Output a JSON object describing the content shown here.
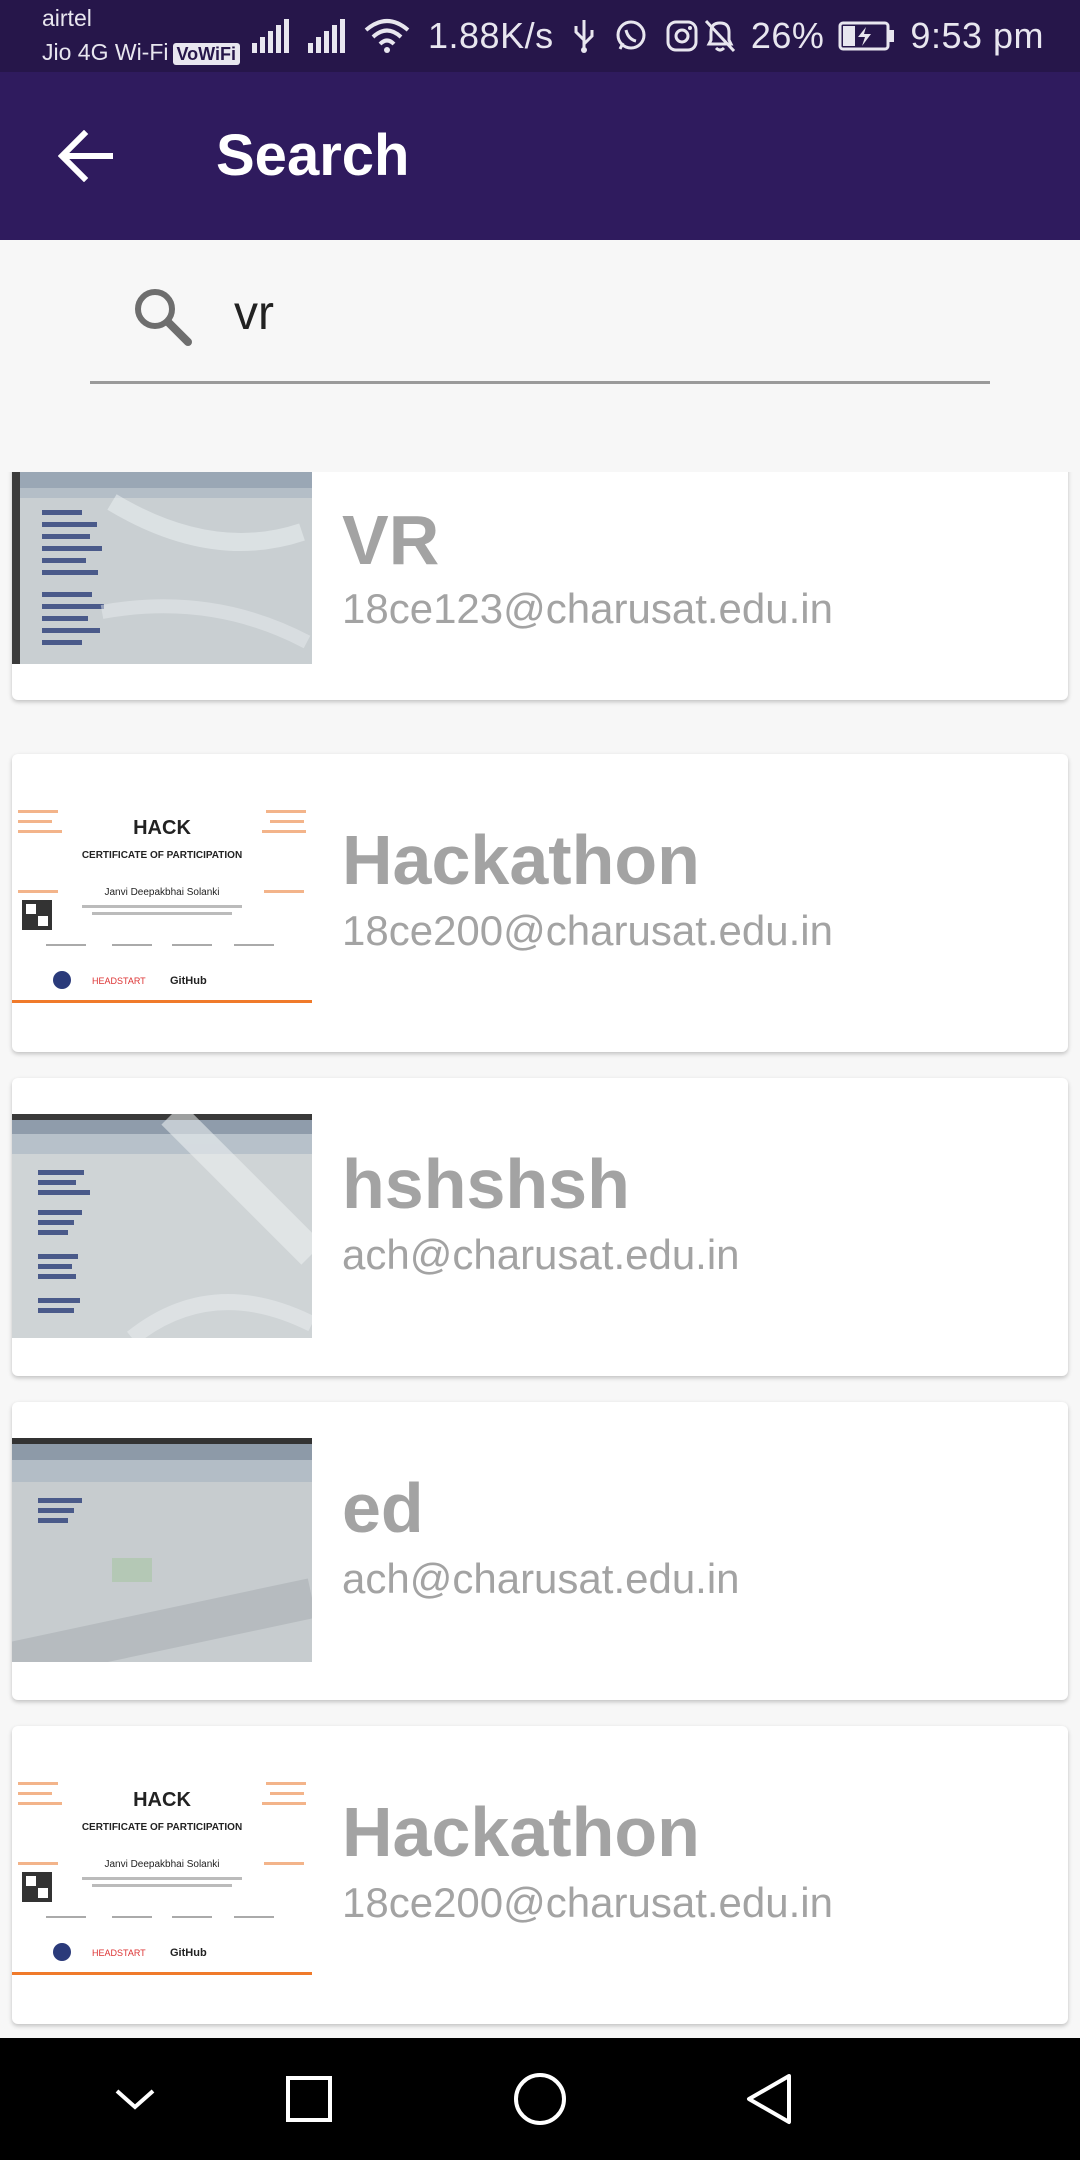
{
  "status_bar": {
    "carrier1": "airtel",
    "carrier2": "Jio 4G Wi-Fi",
    "vowifi": "VoWiFi",
    "speed": "1.88K/s",
    "battery": "26%",
    "time": "9:53 pm"
  },
  "appbar": {
    "title": "Search"
  },
  "search": {
    "query": "vr",
    "placeholder": ""
  },
  "results": [
    {
      "title": "VR",
      "email": "18ce123@charusat.edu.in",
      "thumb": "screen-photo"
    },
    {
      "title": "Hackathon",
      "email": "18ce200@charusat.edu.in",
      "thumb": "certificate"
    },
    {
      "title": "hshshsh",
      "email": "ach@charusat.edu.in",
      "thumb": "screen-photo"
    },
    {
      "title": "ed",
      "email": "ach@charusat.edu.in",
      "thumb": "screen-photo"
    },
    {
      "title": "Hackathon",
      "email": "18ce200@charusat.edu.in",
      "thumb": "certificate"
    }
  ],
  "certificate": {
    "logo": "HACK",
    "heading": "CERTIFICATE OF PARTICIPATION",
    "name": "Janvi Deepakbhai Solanki",
    "sponsor1": "HEADSTART",
    "sponsor2": "GitHub"
  },
  "colors": {
    "status_bar": "#26164a",
    "app_bar": "#2f1b5e",
    "card_text": "#a3a3a3"
  }
}
